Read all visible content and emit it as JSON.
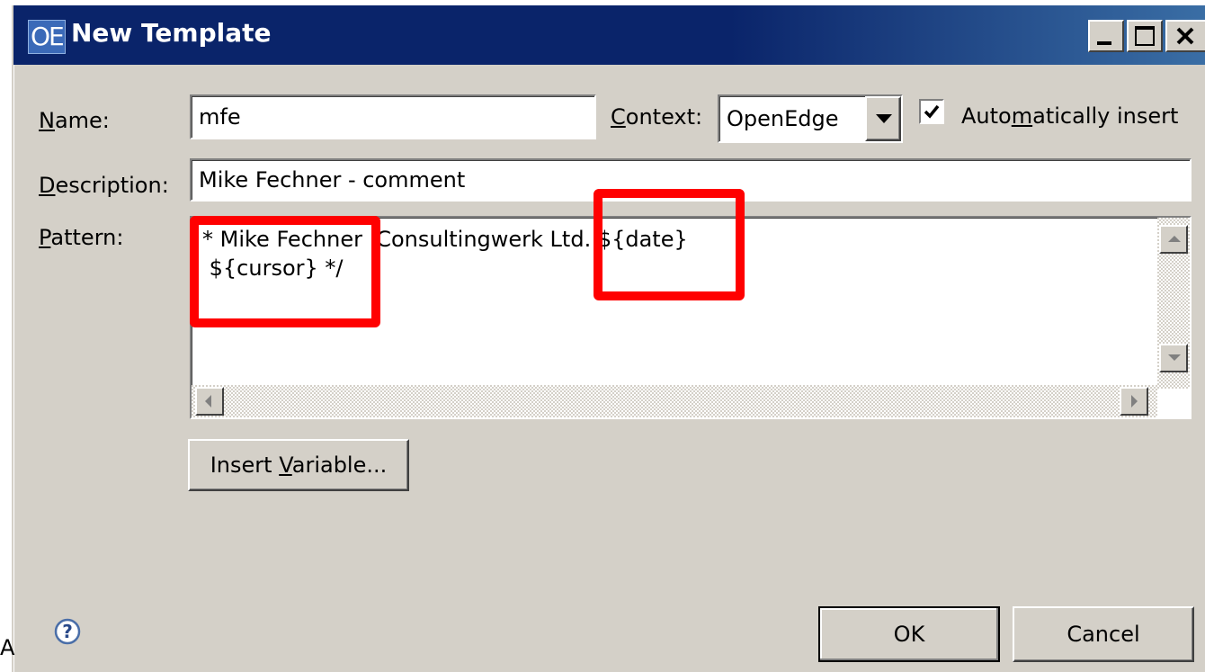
{
  "window": {
    "app_logo": "OE",
    "title": "New Template"
  },
  "form": {
    "name_label": "Name:",
    "name_value": "mfe",
    "context_label": "Context:",
    "context_value": "OpenEdge",
    "auto_insert_label": "Automatically insert",
    "auto_insert_checked": true,
    "description_label": "Description:",
    "description_value": "Mike Fechner - comment",
    "pattern_label": "Pattern:",
    "pattern_value": "* Mike Fechner  Consultingwerk Ltd. ${date}\n ${cursor} */"
  },
  "buttons": {
    "insert_variable": "Insert Variable...",
    "ok": "OK",
    "cancel": "Cancel"
  },
  "edge_text": "A",
  "colors": {
    "title_bar": "#0a246a",
    "dialog_bg": "#d4d0c8",
    "highlight": "#ff0000"
  }
}
